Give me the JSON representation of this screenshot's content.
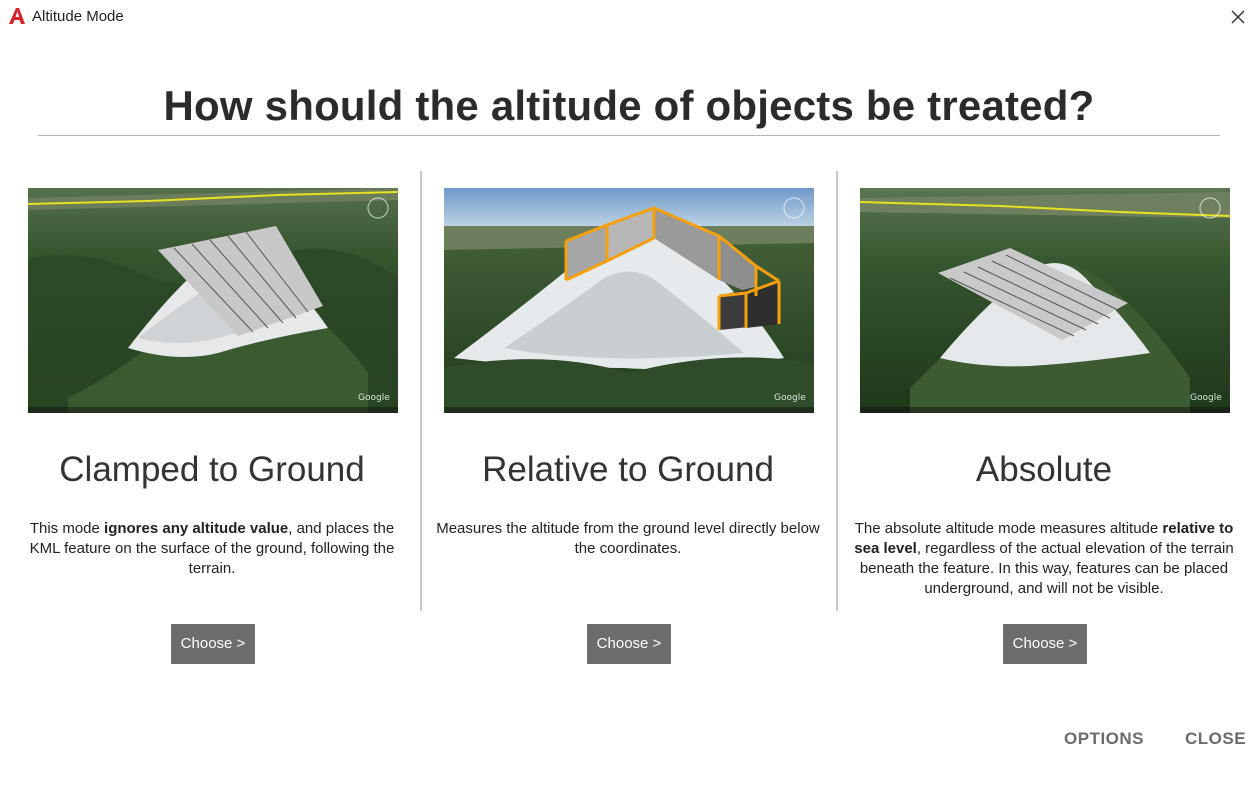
{
  "window": {
    "title": "Altitude Mode",
    "logo_icon": "autocad-logo-icon",
    "close_icon": "close-icon"
  },
  "heading": "How should the altitude of objects be treated?",
  "modes": [
    {
      "title": "Clamped to Ground",
      "desc_pre": "This mode ",
      "desc_bold": "ignores any altitude value",
      "desc_post": ", and places the KML feature on the surface of the ground, following the terrain.",
      "button": "Choose >"
    },
    {
      "title": "Relative to Ground",
      "desc_pre": "Measures the altitude from the ground level directly below the coordinates.",
      "desc_bold": "",
      "desc_post": "",
      "button": "Choose >"
    },
    {
      "title": "Absolute",
      "desc_pre": "The absolute altitude mode measures altitude ",
      "desc_bold": "relative to sea level",
      "desc_post": ", regardless of the actual elevation of the terrain beneath the feature. In this way, features can be placed underground, and will not be visible.",
      "button": "Choose >"
    }
  ],
  "footer": {
    "options": "OPTIONS",
    "close": "CLOSE"
  },
  "colors": {
    "button_bg": "#6d6d6d",
    "footer_text": "#6b6b6b",
    "highlight_orange": "#f5a00f",
    "logo_red": "#d6262b"
  }
}
